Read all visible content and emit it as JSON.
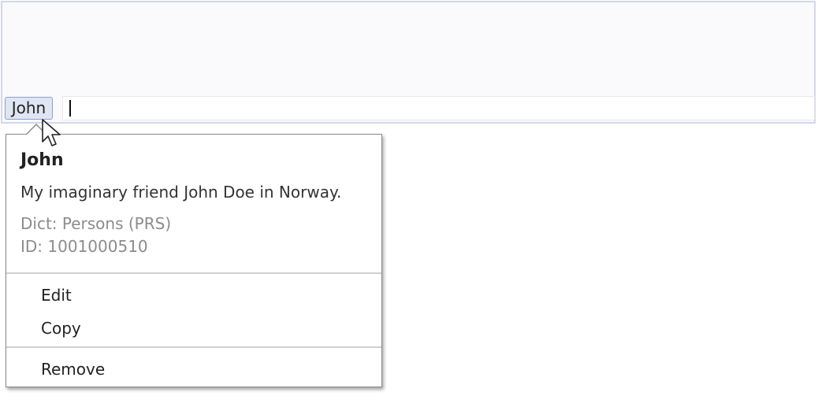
{
  "tag_field": {
    "token_label": "John",
    "input_value": ""
  },
  "popup": {
    "title": "John",
    "description": "My imaginary friend John Doe in Norway.",
    "dict_line": "Dict: Persons (PRS)",
    "id_line": "ID: 1001000510",
    "menu": {
      "edit": "Edit",
      "copy": "Copy",
      "remove": "Remove"
    }
  }
}
